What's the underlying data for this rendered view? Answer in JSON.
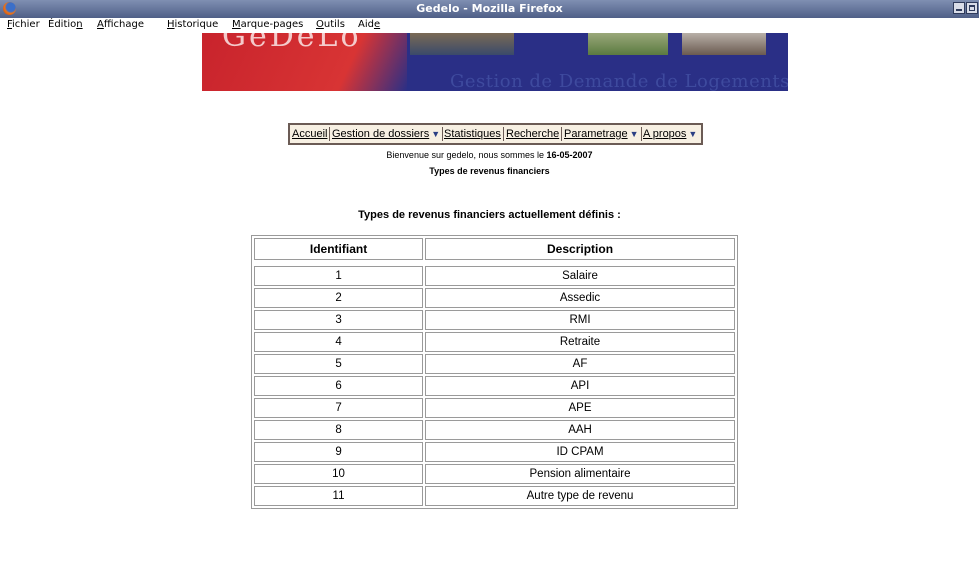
{
  "window": {
    "title": "Gedelo - Mozilla Firefox"
  },
  "menubar": {
    "items": [
      {
        "pre": "",
        "accel": "F",
        "post": "ichier"
      },
      {
        "pre": "Éditio",
        "accel": "n",
        "post": ""
      },
      {
        "pre": "",
        "accel": "A",
        "post": "ffichage"
      },
      {
        "pre": "",
        "accel": "H",
        "post": "istorique"
      },
      {
        "pre": "",
        "accel": "M",
        "post": "arque-pages"
      },
      {
        "pre": "",
        "accel": "O",
        "post": "utils"
      },
      {
        "pre": "Aid",
        "accel": "e",
        "post": ""
      }
    ]
  },
  "banner": {
    "logo_text": "GeDeLo",
    "tagline": "Gestion de Demande de Logements"
  },
  "nav": {
    "items": [
      {
        "label": "Accueil",
        "has_dropdown": false
      },
      {
        "label": "Gestion de dossiers",
        "has_dropdown": true
      },
      {
        "label": "Statistiques",
        "has_dropdown": false
      },
      {
        "label": "Recherche",
        "has_dropdown": false
      },
      {
        "label": "Parametrage",
        "has_dropdown": true
      },
      {
        "label": "A propos",
        "has_dropdown": true
      }
    ],
    "dropdown_glyph": "▼"
  },
  "welcome": {
    "text": "Bienvenue sur gedelo, nous sommes le ",
    "date": "16-05-2007"
  },
  "page_title": "Types de revenus financiers",
  "section_heading": "Types de revenus financiers actuellement définis :",
  "table": {
    "headers": [
      "Identifiant",
      "Description"
    ],
    "rows": [
      [
        "1",
        "Salaire"
      ],
      [
        "2",
        "Assedic"
      ],
      [
        "3",
        "RMI"
      ],
      [
        "4",
        "Retraite"
      ],
      [
        "5",
        "AF"
      ],
      [
        "6",
        "API"
      ],
      [
        "7",
        "APE"
      ],
      [
        "8",
        "AAH"
      ],
      [
        "9",
        "ID CPAM"
      ],
      [
        "10",
        "Pension alimentaire"
      ],
      [
        "11",
        "Autre type de revenu"
      ]
    ]
  },
  "colors": {
    "titlebar": "#5f6f97",
    "nav_background": "#f7f0e3",
    "nav_border": "#6b5b55",
    "banner_red": "#c8232c",
    "banner_blue": "#2a2f86",
    "dropdown_arrow": "#2b3f84"
  }
}
